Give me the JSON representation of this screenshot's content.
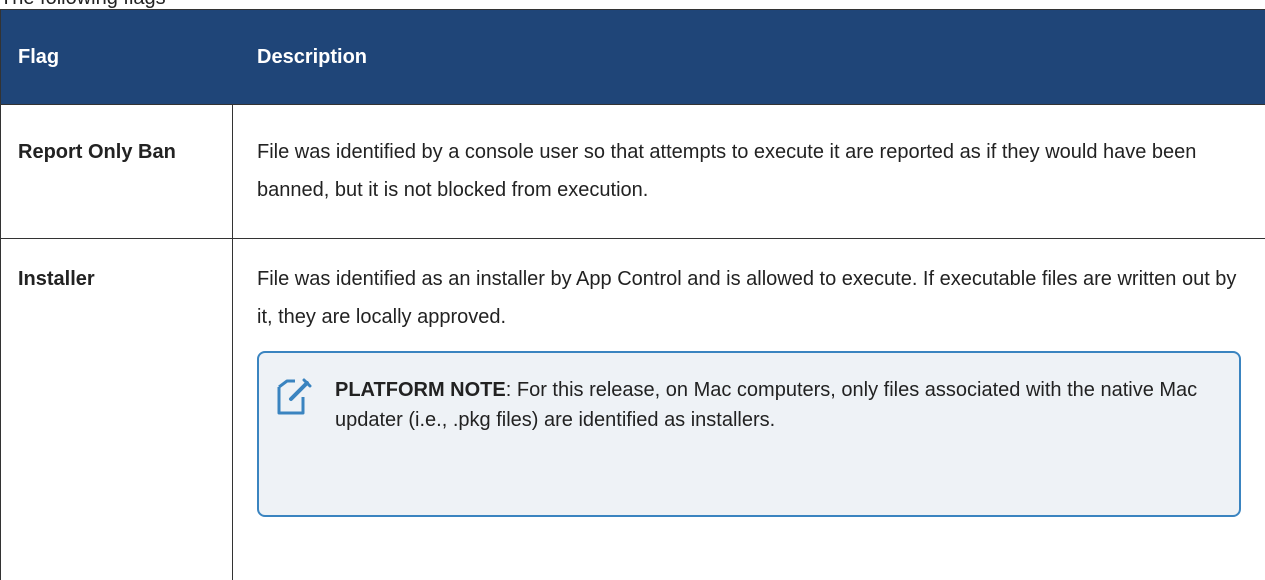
{
  "top_caption": "The following flags",
  "table": {
    "headers": {
      "flag": "Flag",
      "description": "Description"
    },
    "rows": [
      {
        "flag": "Report Only Ban",
        "description": "File was identified by a console user so that attempts to execute it are reported as if they would have been banned, but it is not blocked from execution."
      },
      {
        "flag": "Installer",
        "description": "File was identified as an installer by App Control and is allowed to execute. If executable files are written out by it, they are locally approved."
      }
    ]
  },
  "note": {
    "icon": "note-edit-icon",
    "lead": "PLATFORM NOTE",
    "text": ": For this release, on Mac computers, only files associated with the native Mac updater (i.e., .pkg files) are identified as installers."
  },
  "colors": {
    "header_bg": "#1f4578",
    "note_border": "#3a84c0",
    "note_bg": "#eef2f6"
  }
}
